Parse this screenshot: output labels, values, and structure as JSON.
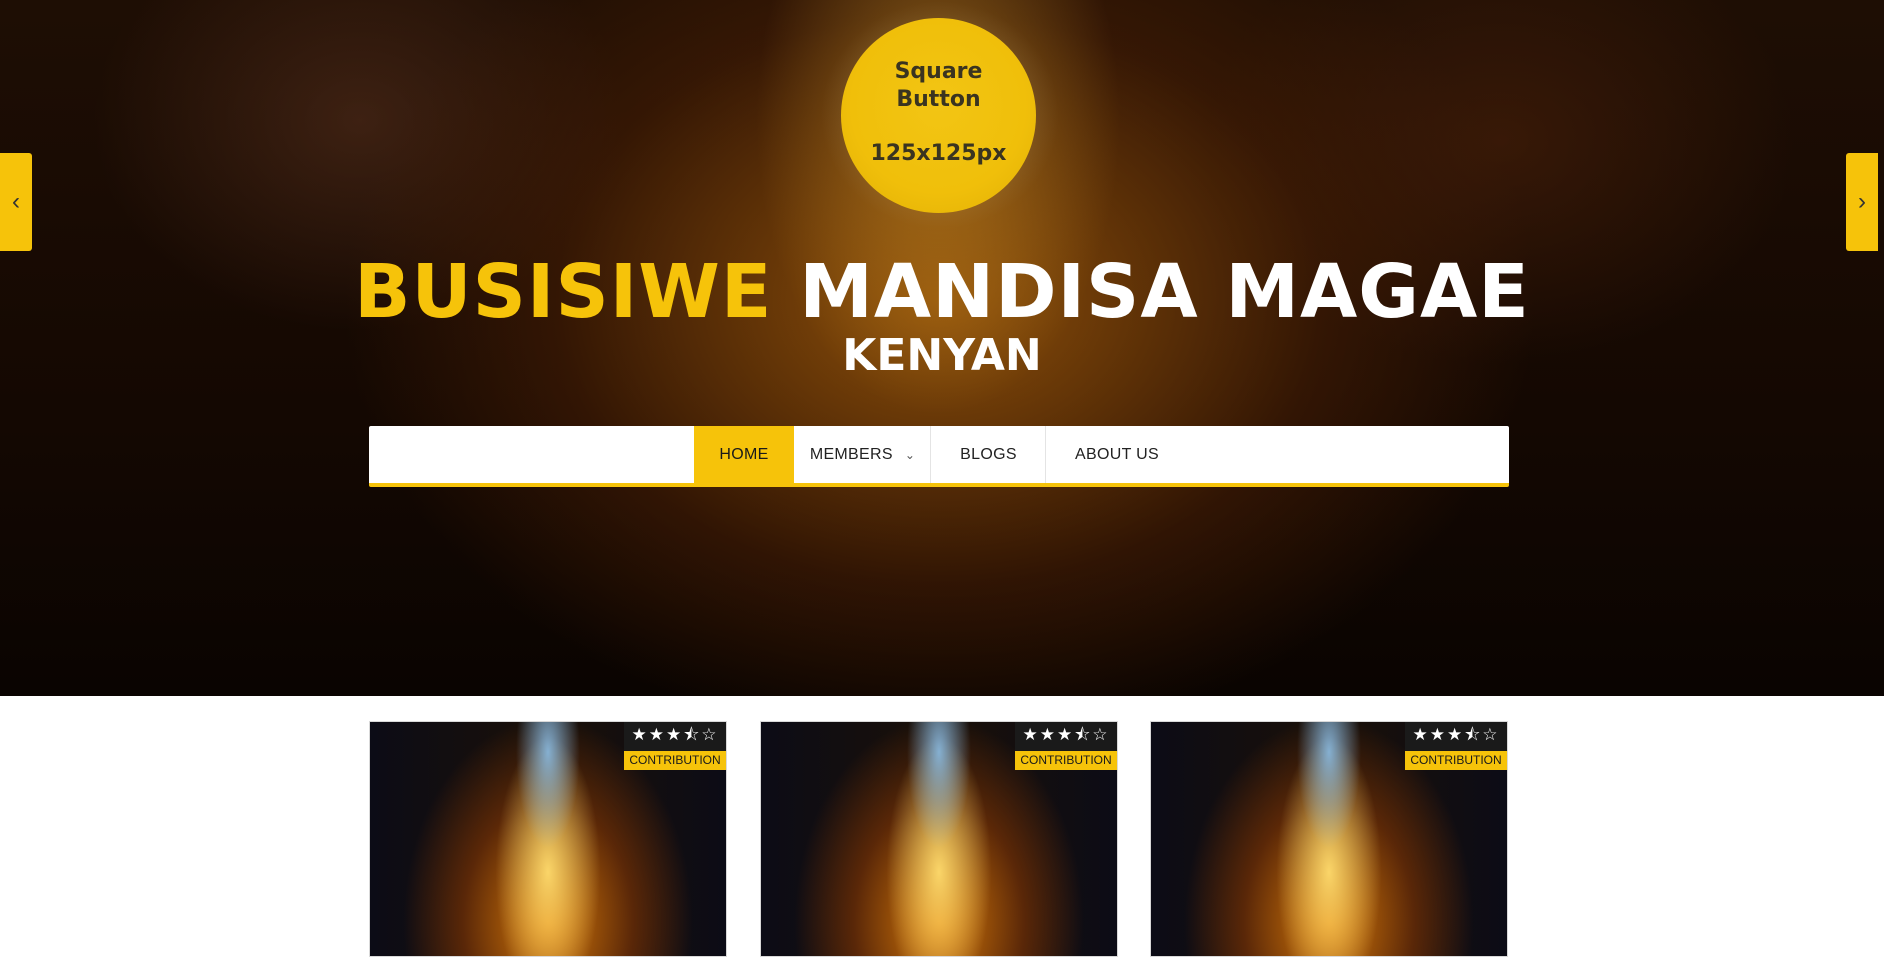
{
  "logo": {
    "line1": "Square",
    "line2": "Button",
    "line3": "125x125px"
  },
  "hero": {
    "first_name": "BUSISIWE",
    "last_name": "MANDISA MAGAE",
    "subtitle": "KENYAN"
  },
  "nav": {
    "items": [
      {
        "label": "HOME",
        "active": true
      },
      {
        "label": "MEMBERS",
        "has_dropdown": true
      },
      {
        "label": "BLOGS"
      },
      {
        "label": "ABOUT US"
      }
    ],
    "dropdown_icon": "chevron-down-icon"
  },
  "slider": {
    "prev_icon": "chevron-left-icon",
    "next_icon": "chevron-right-icon"
  },
  "cards": [
    {
      "rating": 3.5,
      "stars": "★★★⯪☆",
      "tag": "CONTRIBUTION"
    },
    {
      "rating": 3.5,
      "stars": "★★★⯪☆",
      "tag": "CONTRIBUTION"
    },
    {
      "rating": 3.5,
      "stars": "★★★⯪☆",
      "tag": "CONTRIBUTION"
    }
  ],
  "colors": {
    "accent": "#f6c30a",
    "dark": "#1a1a1a"
  }
}
